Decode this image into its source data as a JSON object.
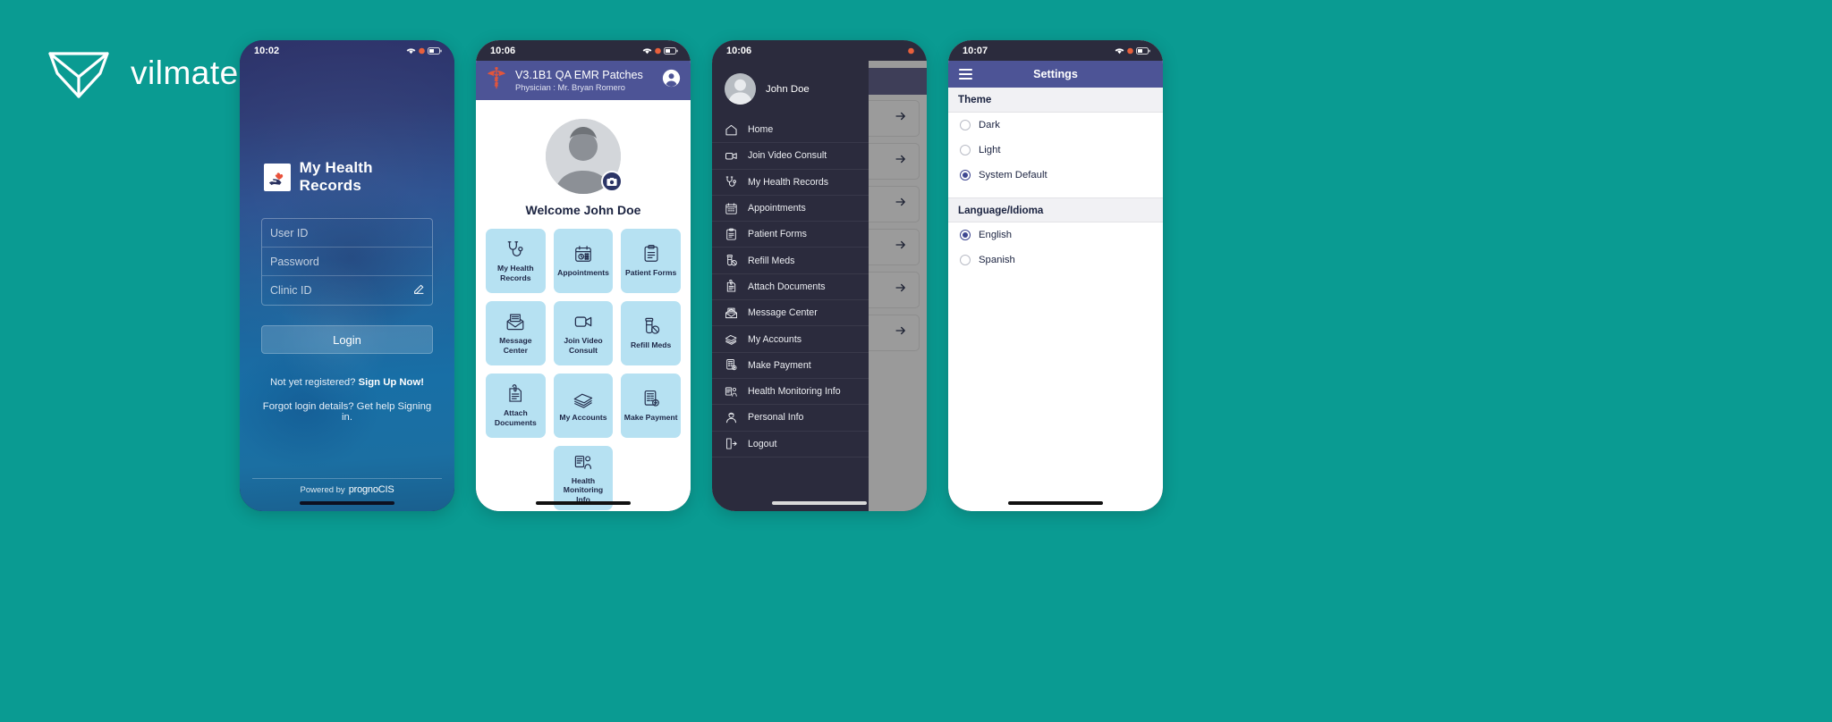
{
  "brand": {
    "name": "vilmate",
    "logo_icon": "vilmate-cube-logo",
    "background_color": "#0a9b92"
  },
  "login": {
    "status_time": "10:02",
    "app_icon": "heart-in-hand-icon",
    "title": "My Health Records",
    "fields": [
      {
        "name": "user-id",
        "placeholder": "User ID",
        "value": ""
      },
      {
        "name": "password",
        "placeholder": "Password",
        "value": ""
      },
      {
        "name": "clinic-id",
        "placeholder": "Clinic ID",
        "value": "",
        "trailing_icon": "edit-icon"
      }
    ],
    "login_button": "Login",
    "signup_prompt": "Not yet registered?",
    "signup_link": "Sign Up Now!",
    "forgot_text": "Forgot login details? Get help Signing in.",
    "powered_by": "Powered by",
    "powered_brand": "prognoCIS"
  },
  "dashboard": {
    "status_time": "10:06",
    "header_icon": "caduceus-icon",
    "header_title": "V3.1B1 QA EMR Patches",
    "header_subtitle": "Physician : Mr. Bryan Romero",
    "account_icon": "account-circle-icon",
    "camera_icon": "camera-icon",
    "welcome": "Welcome  John Doe",
    "tiles": [
      {
        "label": "My Health Records",
        "icon": "stethoscope-icon"
      },
      {
        "label": "Appointments",
        "icon": "calendar-icon"
      },
      {
        "label": "Patient Forms",
        "icon": "clipboard-icon"
      },
      {
        "label": "Message Center",
        "icon": "envelope-icon"
      },
      {
        "label": "Join Video Consult",
        "icon": "video-camera-icon"
      },
      {
        "label": "Refill Meds",
        "icon": "pill-bottle-icon"
      },
      {
        "label": "Attach Documents",
        "icon": "attach-document-icon"
      },
      {
        "label": "My Accounts",
        "icon": "money-stack-icon"
      },
      {
        "label": "Make Payment",
        "icon": "payment-icon"
      },
      {
        "label": "Health Monitoring Info",
        "icon": "health-monitor-icon"
      }
    ],
    "tile_color": "#b6e1f2"
  },
  "drawer": {
    "status_time": "10:06",
    "user_name": "John Doe",
    "avatar_icon": "user-avatar-icon",
    "items": [
      {
        "label": "Home",
        "icon": "home-icon"
      },
      {
        "label": "Join Video Consult",
        "icon": "video-camera-icon"
      },
      {
        "label": "My Health Records",
        "icon": "stethoscope-icon"
      },
      {
        "label": "Appointments",
        "icon": "calendar-icon"
      },
      {
        "label": "Patient Forms",
        "icon": "clipboard-icon"
      },
      {
        "label": "Refill Meds",
        "icon": "pill-bottle-icon"
      },
      {
        "label": "Attach Documents",
        "icon": "attach-document-icon"
      },
      {
        "label": "Message Center",
        "icon": "envelope-icon"
      },
      {
        "label": "My Accounts",
        "icon": "money-stack-icon"
      },
      {
        "label": "Make Payment",
        "icon": "payment-icon"
      },
      {
        "label": "Health Monitoring Info",
        "icon": "health-monitor-icon"
      },
      {
        "label": "Personal Info",
        "icon": "person-info-icon"
      },
      {
        "label": "Logout",
        "icon": "logout-icon"
      }
    ],
    "background_rows": 6,
    "row_arrow_icon": "arrow-right-icon"
  },
  "settings": {
    "status_time": "10:07",
    "menu_icon": "hamburger-menu-icon",
    "title": "Settings",
    "sections": [
      {
        "heading": "Theme",
        "options": [
          {
            "label": "Dark",
            "selected": false
          },
          {
            "label": "Light",
            "selected": false
          },
          {
            "label": "System Default",
            "selected": true
          }
        ]
      },
      {
        "heading": "Language/Idioma",
        "options": [
          {
            "label": "English",
            "selected": true
          },
          {
            "label": "Spanish",
            "selected": false
          }
        ]
      }
    ],
    "accent_color": "#3f4791",
    "header_color": "#4d5496"
  }
}
